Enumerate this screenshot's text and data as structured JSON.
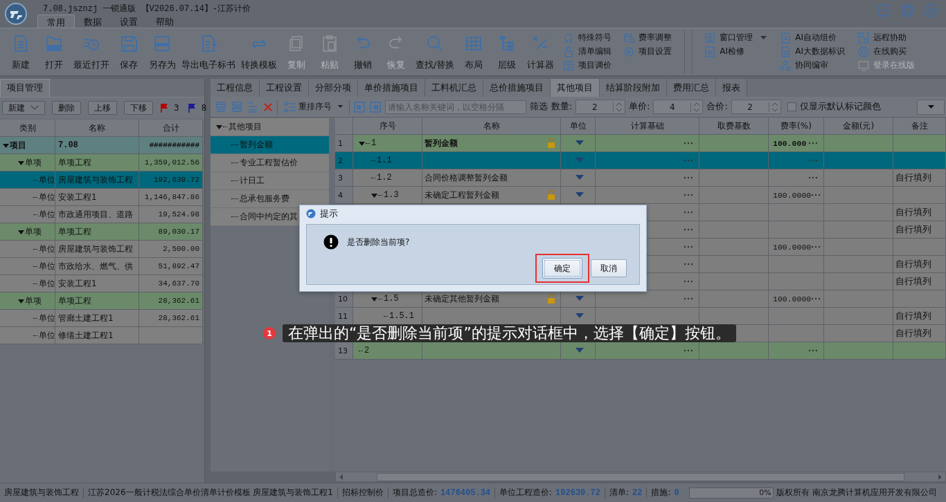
{
  "title_bar": {
    "title": "7.08.jsznzj 一锁通版 【V2026.07.14】-江苏计价"
  },
  "menu_tabs": [
    {
      "label": "常用",
      "selected": true
    },
    {
      "label": "数据",
      "selected": false
    },
    {
      "label": "设置",
      "selected": false
    },
    {
      "label": "帮助",
      "selected": false
    }
  ],
  "ribbon": {
    "large_buttons": [
      {
        "label": "新建",
        "disabled": false
      },
      {
        "label": "打开",
        "disabled": false
      },
      {
        "label": "最近打开",
        "disabled": false
      },
      {
        "label": "保存",
        "disabled": false
      },
      {
        "label": "另存为",
        "disabled": false
      },
      {
        "label": "导出电子标书",
        "disabled": false
      },
      {
        "label": "转换模板",
        "disabled": false
      },
      {
        "label": "复制",
        "disabled": true
      },
      {
        "label": "粘贴",
        "disabled": true
      },
      {
        "label": "撤销",
        "disabled": false
      },
      {
        "label": "恢复",
        "disabled": true
      },
      {
        "label": "查找/替换",
        "disabled": false
      },
      {
        "label": "布局",
        "disabled": false
      },
      {
        "label": "层级",
        "disabled": false
      },
      {
        "label": "计算器",
        "disabled": false
      }
    ],
    "small_columns": [
      [
        {
          "label": "特殊符号",
          "disabled": false
        },
        {
          "label": "清单编辑",
          "disabled": false
        },
        {
          "label": "项目调价",
          "disabled": false
        }
      ],
      [
        {
          "label": "费率调整",
          "disabled": false
        },
        {
          "label": "项目设置",
          "disabled": false
        }
      ]
    ],
    "right_columns": [
      [
        {
          "label": "窗口管理",
          "disabled": false,
          "dropdown": true
        },
        {
          "label": "AI检修",
          "disabled": false,
          "dropdown": false
        }
      ],
      [
        {
          "label": "AI自动组价",
          "disabled": false,
          "dropdown": false
        },
        {
          "label": "AI大数据标识",
          "disabled": false,
          "dropdown": false
        },
        {
          "label": "协同编审",
          "disabled": false,
          "dropdown": false
        }
      ],
      [
        {
          "label": "远程协助",
          "disabled": false,
          "dropdown": false
        },
        {
          "label": "在线购买",
          "disabled": false,
          "dropdown": false
        },
        {
          "label": "登录在线版",
          "disabled": true,
          "dropdown": false
        }
      ]
    ]
  },
  "project_panel": {
    "tab": "项目管理",
    "toolbar": [
      {
        "label": "新建",
        "dropdown": true
      },
      {
        "label": "删除",
        "dropdown": false
      },
      {
        "label": "上移",
        "dropdown": false
      },
      {
        "label": "下移",
        "dropdown": false
      }
    ],
    "flags": [
      {
        "color": "#b40000",
        "count": "3"
      },
      {
        "color": "#1c1c9a",
        "count": "8"
      }
    ],
    "columns": [
      "类别",
      "名称",
      "合计"
    ],
    "tree": [
      {
        "kind": "project",
        "type": "项目",
        "name": "7.08",
        "total": "###########",
        "selected": false,
        "expanded": true,
        "children": [
          {
            "kind": "single",
            "type": "单项",
            "name": "单项工程",
            "total": "1,359,012.56",
            "selected": false,
            "expanded": true,
            "children": [
              {
                "kind": "unit",
                "type": "单位",
                "name": "房屋建筑与装饰工程",
                "total": "192,639.72",
                "selected": true
              },
              {
                "kind": "unit",
                "type": "单位",
                "name": "安装工程1",
                "total": "1,146,847.86",
                "selected": false
              },
              {
                "kind": "unit",
                "type": "单位",
                "name": "市政通用项目、道路",
                "total": "19,524.98",
                "selected": false
              }
            ]
          },
          {
            "kind": "single",
            "type": "单项",
            "name": "单项工程",
            "total": "89,030.17",
            "selected": false,
            "expanded": true,
            "children": [
              {
                "kind": "unit",
                "type": "单位",
                "name": "房屋建筑与装饰工程",
                "total": "2,500.00",
                "selected": false
              },
              {
                "kind": "unit",
                "type": "单位",
                "name": "市政给水、燃气、供",
                "total": "51,892.47",
                "selected": false
              },
              {
                "kind": "unit",
                "type": "单位",
                "name": "安装工程1",
                "total": "34,637.70",
                "selected": false
              }
            ]
          },
          {
            "kind": "single",
            "type": "单项",
            "name": "单项工程",
            "total": "28,362.61",
            "selected": false,
            "expanded": true,
            "children": [
              {
                "kind": "unit",
                "type": "单位",
                "name": "管廊土建工程1",
                "total": "28,362.61",
                "selected": false
              },
              {
                "kind": "unit",
                "type": "单位",
                "name": "修缮土建工程1",
                "selected": false
              }
            ]
          }
        ]
      }
    ]
  },
  "content_tabs": [
    {
      "label": "工程信息",
      "selected": false
    },
    {
      "label": "工程设置",
      "selected": false
    },
    {
      "label": "分部分项",
      "selected": false
    },
    {
      "label": "单价措施项目",
      "selected": false
    },
    {
      "label": "工料机汇总",
      "selected": false
    },
    {
      "label": "总价措施项目",
      "selected": false
    },
    {
      "label": "其他项目",
      "selected": true
    },
    {
      "label": "结算阶段附加",
      "selected": false
    },
    {
      "label": "费用汇总",
      "selected": false
    },
    {
      "label": "报表",
      "selected": false
    }
  ],
  "toolbar": {
    "renumber": "重排序号",
    "search": {
      "placeholder": "请输入名称关键词，以空格分隔"
    },
    "filter": "筛选",
    "spinners": [
      {
        "label": "数量:",
        "value": "2"
      },
      {
        "label": "单价:",
        "value": "4"
      },
      {
        "label": "合价:",
        "value": "2"
      }
    ],
    "checkbox": {
      "label": "仅显示默认标记颜色",
      "checked": false
    }
  },
  "item_tree": {
    "label": "其他项目",
    "expanded": true,
    "children": [
      {
        "label": "暂列金额",
        "selected": true
      },
      {
        "label": "专业工程暂估价",
        "selected": false
      },
      {
        "label": "计日工",
        "selected": false
      },
      {
        "label": "总承包服务费",
        "selected": false
      },
      {
        "label": "合同中约定的其",
        "selected": false
      }
    ]
  },
  "grid": {
    "columns": [
      "序号",
      "名称",
      "单位",
      "计算基础",
      "取费基数",
      "费率(%)",
      "金额(元)",
      "备注"
    ],
    "rows": [
      {
        "kind": "heading",
        "num": "1",
        "seq": "1",
        "name": "暂列金额",
        "locked": true,
        "selected": false,
        "expanded": true,
        "unit_menu": true,
        "calc_menu": true,
        "rate_menu": true,
        "rate": "100.000",
        "children": [
          {
            "kind": "item",
            "num": "2",
            "seq": "1.1",
            "locked": false,
            "selected": true,
            "unit_menu": true,
            "calc_menu": true,
            "rate_menu": true
          },
          {
            "kind": "item",
            "num": "3",
            "seq": "1.2",
            "name": "合同价格调整暂列金额",
            "locked": false,
            "selected": false,
            "unit_menu": true,
            "calc_menu": true,
            "rate_menu": true,
            "note": "自行填列"
          },
          {
            "kind": "item",
            "num": "4",
            "seq": "1.3",
            "name": "未确定工程暂列金额",
            "locked": true,
            "selected": false,
            "expanded": true,
            "unit_menu": true,
            "calc_menu": true,
            "rate_menu": true,
            "rate": "100.0000",
            "children": [
              {
                "kind": "item",
                "locked": false,
                "unit_menu": false,
                "calc_menu": true,
                "rate_menu": false,
                "note": "自行填列"
              },
              {
                "kind": "item",
                "locked": false,
                "unit_menu": false,
                "calc_menu": true,
                "rate_menu": false,
                "note": "自行填列"
              }
            ]
          },
          {
            "kind": "item",
            "locked": false,
            "unit_menu": false,
            "calc_menu": true,
            "rate_menu": true,
            "rate": "100.0000",
            "children": [
              {
                "kind": "item",
                "locked": false,
                "unit_menu": false,
                "calc_menu": true,
                "rate_menu": false,
                "note": "自行填列"
              },
              {
                "kind": "item",
                "locked": false,
                "unit_menu": false,
                "calc_menu": true,
                "rate_menu": false,
                "note": "自行填列"
              }
            ]
          },
          {
            "kind": "item",
            "num": "10",
            "seq": "1.5",
            "name": "未确定其他暂列金额",
            "locked": true,
            "selected": false,
            "expanded": true,
            "unit_menu": true,
            "calc_menu": true,
            "rate_menu": true,
            "rate": "100.0000",
            "children": [
              {
                "kind": "item",
                "num": "11",
                "seq": "1.5.1",
                "locked": false,
                "selected": false,
                "unit_menu": true,
                "calc_menu": false,
                "rate_menu": false,
                "note": "自行填列"
              },
              {
                "kind": "item",
                "locked": false,
                "unit_menu": false,
                "calc_menu": false,
                "rate_menu": false,
                "note": "自行填列"
              }
            ]
          }
        ]
      },
      {
        "kind": "heading",
        "num": "13",
        "seq": "2",
        "locked": false,
        "selected": false,
        "unit_menu": true,
        "calc_menu": true,
        "rate_menu": true
      }
    ]
  },
  "dialog": {
    "title": "提示",
    "message": "是否删除当前项?",
    "buttons": [
      {
        "label": "确定",
        "highlighted": true
      },
      {
        "label": "取消",
        "highlighted": false
      }
    ]
  },
  "callout": {
    "badge": "1",
    "text": "在弹出的“是否删除当前项”的提示对话框中，选择【确定】按钮。"
  },
  "status_bar": {
    "items": [
      {
        "label": "房屋建筑与装饰工程"
      },
      {
        "label": "江苏2026一般计税法综合单价清单计价模板 房屋建筑与装饰工程1"
      },
      {
        "label": "招标控制价"
      },
      {
        "label": "项目总造价:",
        "value": "1476405.34"
      },
      {
        "label": "单位工程造价:",
        "value": "192639.72"
      },
      {
        "label": "清单:",
        "value": "22"
      },
      {
        "label": "措施:",
        "value": "0"
      }
    ],
    "progress": {
      "level": 0,
      "text": "0%"
    },
    "copyright": "版权所有",
    "company": "南京龙腾计算机应用开发有限公司"
  }
}
